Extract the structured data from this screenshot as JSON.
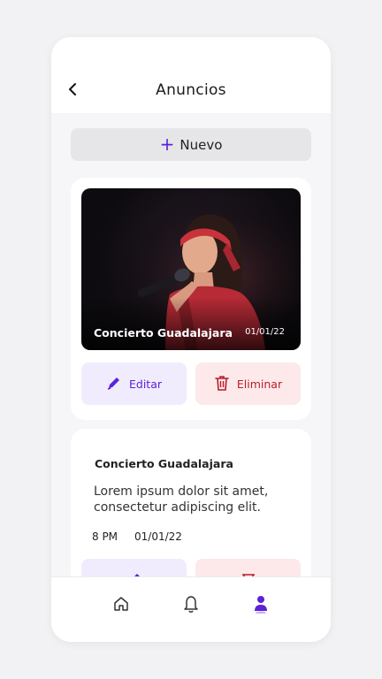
{
  "header": {
    "title": "Anuncios",
    "back_icon": "chevron-left-icon"
  },
  "new_button": {
    "label": "Nuevo",
    "icon": "plus-icon"
  },
  "cards": [
    {
      "title": "Concierto Guadalajara",
      "date": "01/01/22",
      "edit_label": "Editar",
      "delete_label": "Eliminar"
    },
    {
      "title": "Concierto Guadalajara",
      "description": "Lorem ipsum dolor sit amet, consectetur adipiscing elit.",
      "time": "8 PM",
      "date": "01/01/22"
    }
  ],
  "tabbar": {
    "items": [
      "home-icon",
      "bell-icon",
      "user-icon"
    ],
    "active": "user-icon"
  },
  "colors": {
    "accent": "#5b22d8",
    "danger": "#b81d2a",
    "edit_bg": "#f1ecfd",
    "delete_bg": "#fde9ea"
  }
}
